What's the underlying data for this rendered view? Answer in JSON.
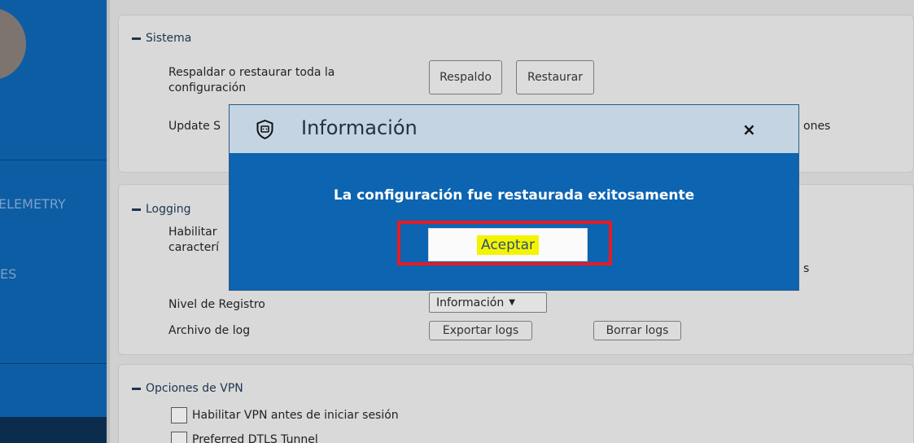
{
  "sidebar": {
    "items": [
      {
        "label": "ELEMETRY"
      },
      {
        "label": "ES"
      }
    ]
  },
  "sistema": {
    "title": "Sistema",
    "backup_label": "Respaldar o restaurar toda la configuración",
    "backup_button": "Respaldo",
    "restore_button": "Restaurar",
    "update_label_partial": "Update S",
    "right_partial": "ones"
  },
  "logging": {
    "title": "Logging",
    "enable_label_partial_1": "Habilitar",
    "enable_label_partial_2": "caracterí",
    "right_partial": "s",
    "level_label": "Nivel de Registro",
    "level_value": "Información",
    "level_arrow": "▼",
    "logfile_label": "Archivo de log",
    "export_button": "Exportar logs",
    "clear_button": "Borrar logs"
  },
  "vpn": {
    "title": "Opciones de VPN",
    "options": [
      {
        "label": "Habilitar VPN antes de iniciar sesión",
        "checked": false
      },
      {
        "label": "Preferred DTLS Tunnel",
        "checked": false
      }
    ]
  },
  "dialog": {
    "title": "Información",
    "close": "×",
    "message": "La configuración fue restaurada exitosamente",
    "ok_button": "Aceptar"
  }
}
